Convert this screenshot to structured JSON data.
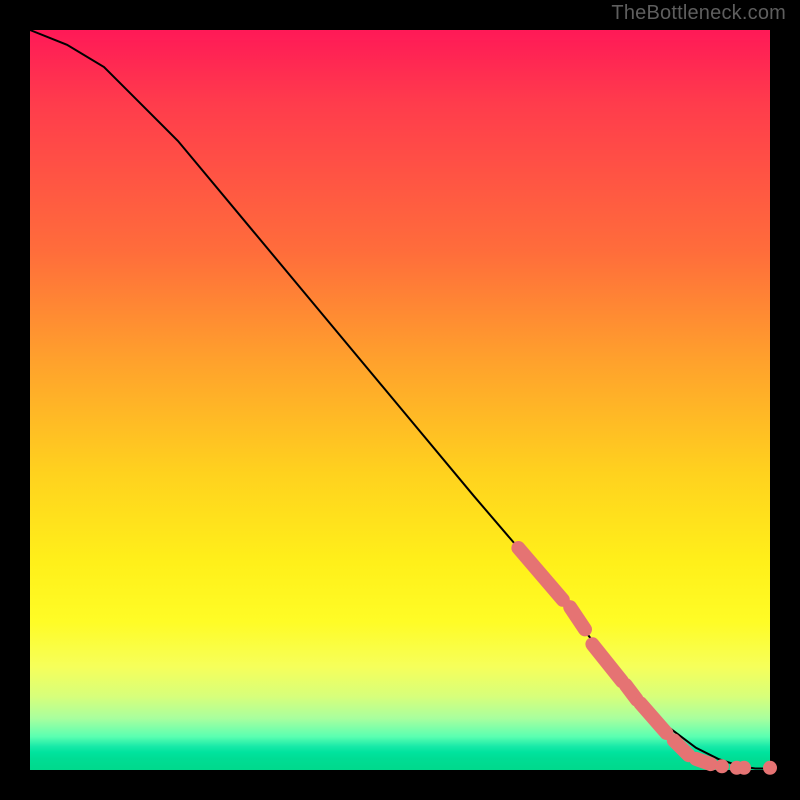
{
  "attribution": "TheBottleneck.com",
  "chart_data": {
    "type": "line",
    "title": "",
    "xlabel": "",
    "ylabel": "",
    "xlim": [
      0,
      100
    ],
    "ylim": [
      0,
      100
    ],
    "grid": false,
    "legend": null,
    "curve": {
      "x": [
        0,
        5,
        10,
        20,
        30,
        40,
        50,
        60,
        66,
        70,
        74,
        78,
        82,
        86,
        90,
        93,
        96,
        98,
        100
      ],
      "y": [
        100,
        98,
        95,
        85,
        73,
        61,
        49,
        37,
        30,
        25,
        20,
        15,
        10,
        6,
        3,
        1.5,
        0.5,
        0.2,
        0.2
      ]
    },
    "marker_segments": [
      {
        "x0": 66,
        "y0": 30,
        "x1": 72,
        "y1": 23
      },
      {
        "x0": 73,
        "y0": 22,
        "x1": 75,
        "y1": 19
      },
      {
        "x0": 76,
        "y0": 17,
        "x1": 80,
        "y1": 12
      },
      {
        "x0": 80.5,
        "y0": 11.5,
        "x1": 82,
        "y1": 9.5
      },
      {
        "x0": 82.5,
        "y0": 9,
        "x1": 86,
        "y1": 5
      },
      {
        "x0": 87,
        "y0": 4,
        "x1": 89,
        "y1": 2
      },
      {
        "x0": 90,
        "y0": 1.5,
        "x1": 92,
        "y1": 0.8
      }
    ],
    "marker_dots": [
      {
        "x": 93.5,
        "y": 0.5
      },
      {
        "x": 95.5,
        "y": 0.3
      },
      {
        "x": 96.5,
        "y": 0.3
      },
      {
        "x": 100,
        "y": 0.3
      }
    ],
    "marker_style": {
      "color": "#e57373",
      "thickness": 14
    }
  }
}
